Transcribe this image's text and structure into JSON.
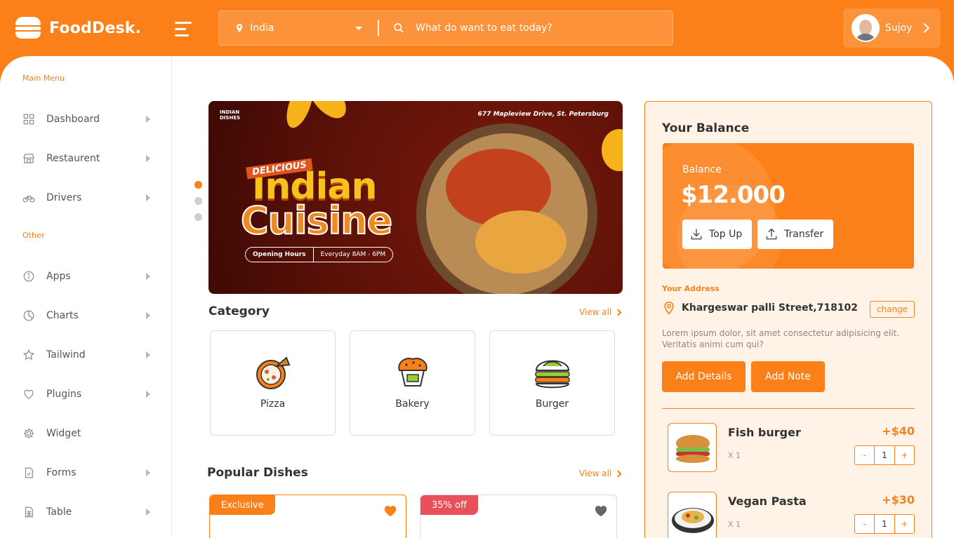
{
  "header": {
    "brand": "FoodDesk.",
    "location": "India",
    "search_placeholder": "What do want to eat today?",
    "user_name": "Sujoy"
  },
  "sidebar": {
    "main_menu_label": "Main Menu",
    "other_label": "Other",
    "main_items": [
      {
        "label": "Dashboard",
        "icon": "grid-icon"
      },
      {
        "label": "Restaurent",
        "icon": "store-icon"
      },
      {
        "label": "Drivers",
        "icon": "bicycle-icon"
      }
    ],
    "other_items": [
      {
        "label": "Apps",
        "icon": "info-icon"
      },
      {
        "label": "Charts",
        "icon": "pie-chart-icon"
      },
      {
        "label": "Tailwind",
        "icon": "star-icon"
      },
      {
        "label": "Plugins",
        "icon": "heart-icon"
      },
      {
        "label": "Widget",
        "icon": "gear-icon"
      },
      {
        "label": "Forms",
        "icon": "form-icon"
      },
      {
        "label": "Table",
        "icon": "table-icon"
      }
    ]
  },
  "banner": {
    "brand_line1": "INDIAN",
    "brand_line2": "DISHES",
    "address": "677 Mapleview Drive, St. Petersburg",
    "tag": "DELICIOUS",
    "title_line1": "Indian",
    "title_line2": "Cuisine",
    "hours_label": "Opening Hours",
    "hours_value": "Everyday 8AM - 6PM"
  },
  "category": {
    "title": "Category",
    "view_all": "View all",
    "items": [
      "Pizza",
      "Bakery",
      "Burger"
    ]
  },
  "popular": {
    "title": "Popular Dishes",
    "view_all": "View all",
    "badges": [
      "Exclusive",
      "35% off"
    ]
  },
  "balance": {
    "title": "Your Balance",
    "label": "Balance",
    "amount": "$12.000",
    "top_up": "Top Up",
    "transfer": "Transfer"
  },
  "address": {
    "label": "Your Address",
    "value": "Khargeswar palli Street,718102",
    "change": "change",
    "description": "Lorem ipsum dolor, sit amet consectetur adipisicing elit. Veritatis animi cum qui?",
    "add_details": "Add Details",
    "add_note": "Add Note"
  },
  "orders": [
    {
      "name": "Fish burger",
      "qty": "X 1",
      "price": "+$40",
      "count": "1",
      "minus": "-",
      "plus": "+"
    },
    {
      "name": "Vegan Pasta",
      "qty": "X 1",
      "price": "+$30",
      "count": "1",
      "minus": "-",
      "plus": "+"
    }
  ],
  "colors": {
    "accent": "#fc8019",
    "discount": "#e8505b"
  }
}
